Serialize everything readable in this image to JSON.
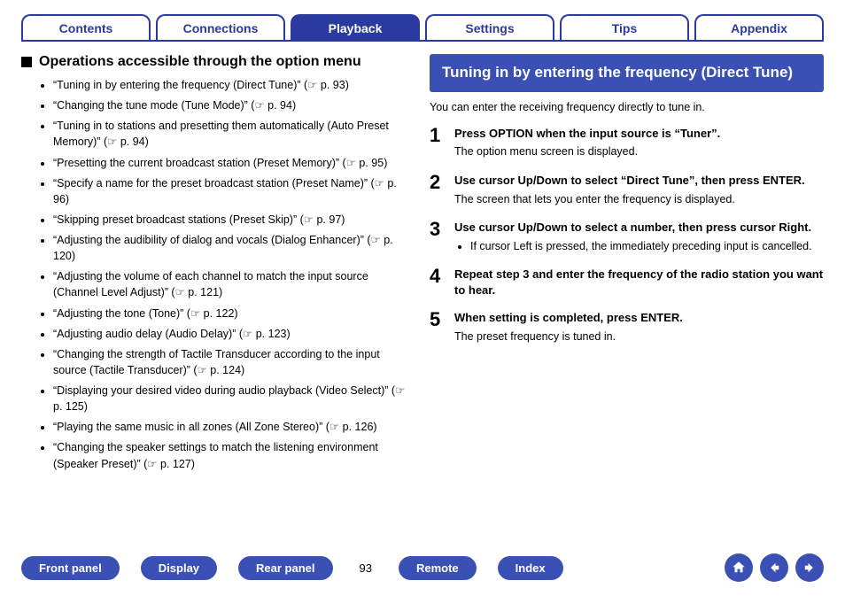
{
  "tabs": [
    {
      "label": "Contents",
      "active": false
    },
    {
      "label": "Connections",
      "active": false
    },
    {
      "label": "Playback",
      "active": true
    },
    {
      "label": "Settings",
      "active": false
    },
    {
      "label": "Tips",
      "active": false
    },
    {
      "label": "Appendix",
      "active": false
    }
  ],
  "left": {
    "heading": "Operations accessible through the option menu",
    "items": [
      {
        "text": "“Tuning in by entering the frequency (Direct Tune)”",
        "page": "p. 93"
      },
      {
        "text": "“Changing the tune mode (Tune Mode)”",
        "page": "p. 94"
      },
      {
        "text": "“Tuning in to stations and presetting them automatically (Auto Preset Memory)”",
        "page": "p. 94"
      },
      {
        "text": "“Presetting the current broadcast station (Preset Memory)”",
        "page": "p. 95"
      },
      {
        "text": "“Specify a name for the preset broadcast station (Preset Name)”",
        "page": "p. 96"
      },
      {
        "text": "“Skipping preset broadcast stations (Preset Skip)”",
        "page": "p. 97"
      },
      {
        "text": "“Adjusting the audibility of dialog and vocals (Dialog Enhancer)”",
        "page": "p. 120"
      },
      {
        "text": "“Adjusting the volume of each channel to match the input source (Channel Level Adjust)”",
        "page": "p. 121"
      },
      {
        "text": "“Adjusting the tone (Tone)”",
        "page": "p. 122"
      },
      {
        "text": "“Adjusting audio delay (Audio Delay)”",
        "page": "p. 123"
      },
      {
        "text": "“Changing the strength of Tactile Transducer according to the input source (Tactile Transducer)”",
        "page": "p. 124"
      },
      {
        "text": "“Displaying your desired video during audio playback (Video Select)”",
        "page": "p. 125"
      },
      {
        "text": "“Playing the same music in all zones (All Zone Stereo)”",
        "page": "p. 126"
      },
      {
        "text": "“Changing the speaker settings to match the listening environment (Speaker Preset)”",
        "page": "p. 127"
      }
    ]
  },
  "right": {
    "heading": "Tuning in by entering the frequency (Direct Tune)",
    "intro": "You can enter the receiving frequency directly to tune in.",
    "steps": [
      {
        "num": "1",
        "title": "Press OPTION when the input source is “Tuner”.",
        "desc": "The option menu screen is displayed."
      },
      {
        "num": "2",
        "title": "Use cursor Up/Down to select “Direct Tune”, then press ENTER.",
        "desc": "The screen that lets you enter the frequency is displayed."
      },
      {
        "num": "3",
        "title": "Use cursor Up/Down to select a number, then press cursor Right.",
        "sub": "If cursor Left is pressed, the immediately preceding input is cancelled."
      },
      {
        "num": "4",
        "title": "Repeat step 3 and enter the frequency of the radio station you want to hear."
      },
      {
        "num": "5",
        "title": "When setting is completed, press ENTER.",
        "desc": "The preset frequency is tuned in."
      }
    ]
  },
  "footer": {
    "buttons_left": [
      "Front panel",
      "Display",
      "Rear panel"
    ],
    "page_number": "93",
    "buttons_right": [
      "Remote",
      "Index"
    ],
    "nav": [
      "home",
      "prev",
      "next"
    ]
  },
  "glyphs": {
    "link": "☞"
  }
}
